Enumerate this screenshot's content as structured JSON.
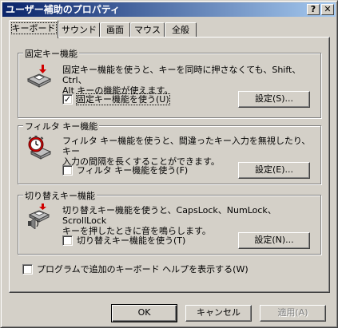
{
  "window": {
    "title": "ユーザー補助のプロパティ",
    "help_glyph": "?",
    "close_glyph": "✕"
  },
  "tabs": [
    {
      "label": "キーボード",
      "active": true
    },
    {
      "label": "サウンド",
      "active": false
    },
    {
      "label": "画面",
      "active": false
    },
    {
      "label": "マウス",
      "active": false
    },
    {
      "label": "全般",
      "active": false
    }
  ],
  "groups": {
    "sticky": {
      "title": "固定キー機能",
      "desc_line1": "固定キー機能を使うと、キーを同時に押さなくても、Shift、Ctrl、",
      "desc_line2": "Alt キーの機能が使えます。",
      "checkbox_label": "固定キー機能を使う(U)",
      "checked": true,
      "check_glyph": "✓",
      "settings_label": "設定(S)...",
      "icon": "keyboard-arrow-icon"
    },
    "filter": {
      "title": "フィルタ キー機能",
      "desc_line1": "フィルタ キー機能を使うと、間違ったキー入力を無視したり、キー",
      "desc_line2": "入力の間隔を長くすることができます。",
      "checkbox_label": "フィルタ キー機能を使う(F)",
      "checked": false,
      "settings_label": "設定(E)...",
      "icon": "stopwatch-keyboard-icon"
    },
    "toggle": {
      "title": "切り替えキー機能",
      "desc_line1": "切り替えキー機能を使うと、CapsLock、NumLock、ScrollLock",
      "desc_line2": "キーを押したときに音を鳴らします。",
      "checkbox_label": "切り替えキー機能を使う(T)",
      "checked": false,
      "settings_label": "設定(N)...",
      "icon": "speaker-keyboard-icon"
    }
  },
  "extra_help": {
    "label": "プログラムで追加のキーボード ヘルプを表示する(W)",
    "checked": false
  },
  "footer": {
    "ok_label": "OK",
    "cancel_label": "キャンセル",
    "apply_label": "適用(A)"
  },
  "colors": {
    "face": "#d4d0c8",
    "title_start": "#0a246a",
    "title_end": "#a6caf0",
    "icon_red": "#d00000"
  }
}
